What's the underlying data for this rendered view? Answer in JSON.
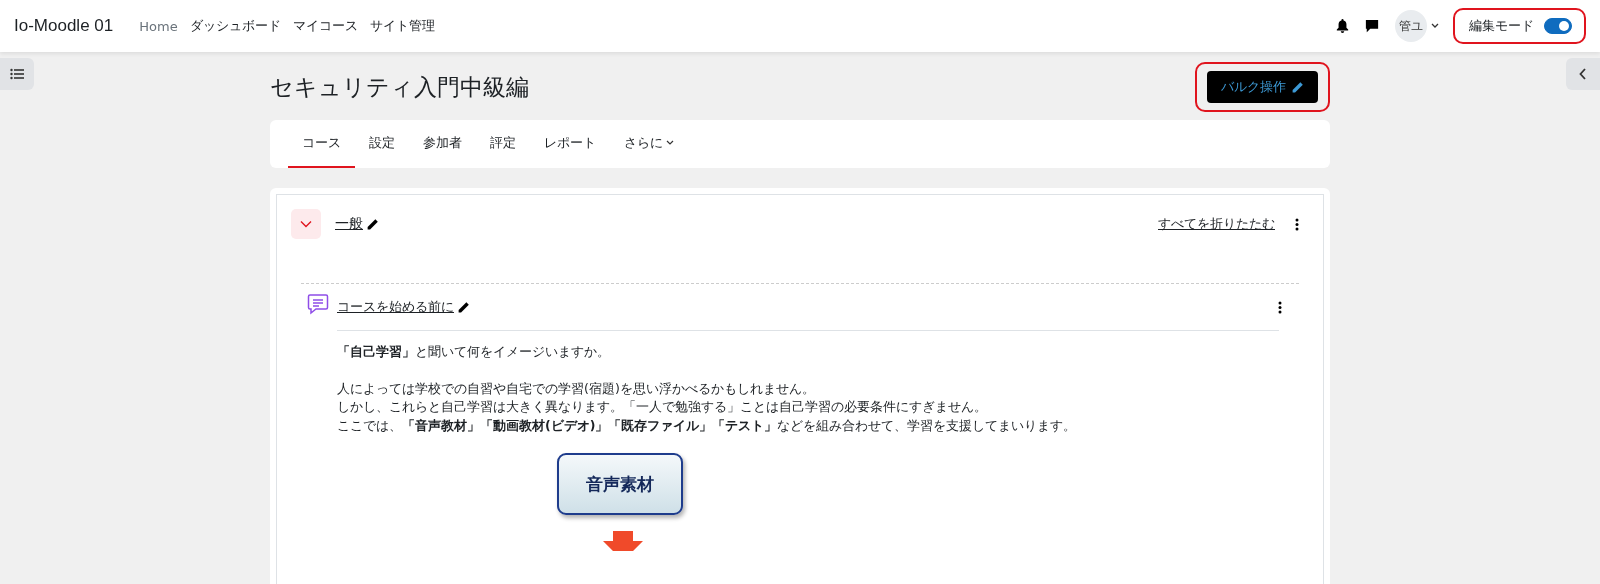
{
  "navbar": {
    "site_name": "Io-Moodle 01",
    "links": [
      {
        "label": "Home",
        "muted": true
      },
      {
        "label": "ダッシュボード",
        "muted": false
      },
      {
        "label": "マイコース",
        "muted": false
      },
      {
        "label": "サイト管理",
        "muted": false
      }
    ],
    "user_initials": "管ユ",
    "edit_mode": {
      "label": "編集モード",
      "on": true,
      "highlighted": true
    }
  },
  "course": {
    "title": "セキュリティ入門中級編",
    "bulk_button": {
      "label": "バルク操作",
      "highlighted": true
    },
    "tabs": [
      {
        "label": "コース",
        "selected": true
      },
      {
        "label": "設定",
        "selected": false
      },
      {
        "label": "参加者",
        "selected": false
      },
      {
        "label": "評定",
        "selected": false
      },
      {
        "label": "レポート",
        "selected": false
      },
      {
        "label": "さらに",
        "selected": false,
        "kind": "dropdown"
      }
    ]
  },
  "section": {
    "title": "一般",
    "expanded": true,
    "collapse_all": "すべてを折りたたむ",
    "activity": {
      "title": "コースを始める前に",
      "paragraphs": [
        {
          "lines": [
            "**「自己学習」**と聞いて何をイメージいますか。"
          ]
        },
        {
          "lines": [
            "人によっては学校での自習や自宅での学習(宿題)を思い浮かべるかもしれません。",
            "しかし、これらと自己学習は大きく異なります。「一人で勉強する」ことは自己学習の必要条件にすぎません。",
            "ここでは、**「音声教材」「動画教材(ビデオ)」「既存ファイル」「テスト」**などを組み合わせて、学習を支援してまいります。"
          ]
        }
      ],
      "diagram_box": "音声素材"
    }
  }
}
